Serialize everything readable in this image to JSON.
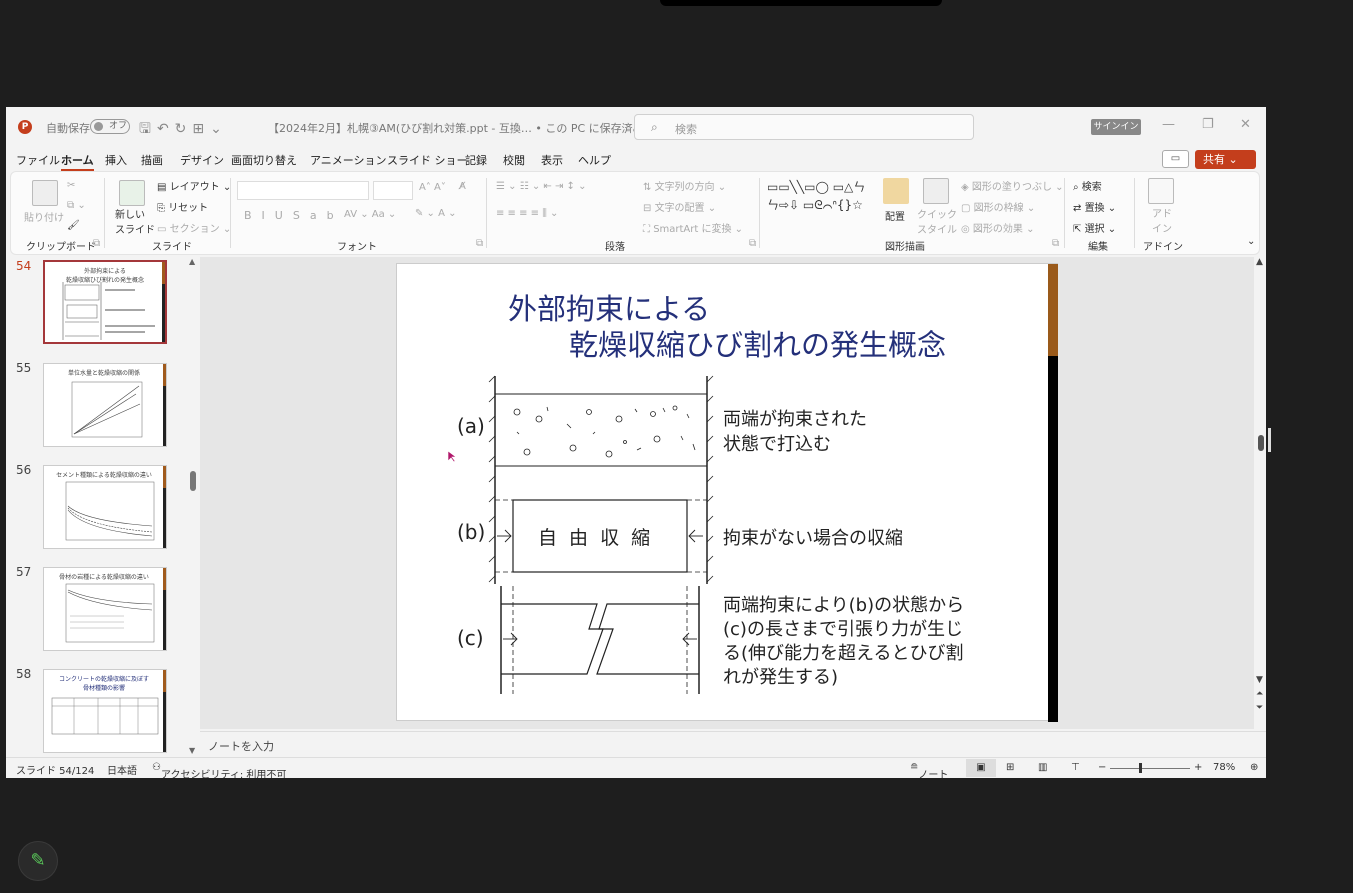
{
  "title_bar": {
    "autosave_label": "自動保存",
    "autosave_state": "オフ",
    "document_title": "【2024年2月】札幌③AM(ひび割れ対策.ppt  -  互換…  •  この PC に保存済み ⌄",
    "search_placeholder": "検索",
    "signin_label": "サインイン"
  },
  "menu": [
    "ファイル",
    "ホーム",
    "挿入",
    "描画",
    "デザイン",
    "画面切り替え",
    "アニメーション",
    "スライド ショー",
    "記録",
    "校閲",
    "表示",
    "ヘルプ"
  ],
  "active_menu": "ホーム",
  "share_label": "共有",
  "ribbon": {
    "paste_label": "貼り付け",
    "new_slide_label": "新しい\nスライド",
    "layout_label": "レイアウト",
    "reset_label": "リセット",
    "section_label": "セクション",
    "text_direction_label": "文字列の方向",
    "text_align_label": "文字の配置",
    "smartart_label": "SmartArt に変換",
    "arrange_label": "配置",
    "quick_style_label": "クイック\nスタイル",
    "shape_fill_label": "図形の塗りつぶし",
    "shape_outline_label": "図形の枠線",
    "shape_effect_label": "図形の効果",
    "find_label": "検索",
    "replace_label": "置換",
    "select_label": "選択",
    "addin_label": "アド\nイン",
    "groups": {
      "clipboard": "クリップボード",
      "slides": "スライド",
      "font": "フォント",
      "paragraph": "段落",
      "drawing": "図形描画",
      "editing": "編集",
      "addins": "アドイン"
    }
  },
  "thumbnails": [
    {
      "number": "54",
      "title": "外部拘束による\n乾燥収縮ひび割れの発生概念",
      "current": true
    },
    {
      "number": "55",
      "title": "単位水量と乾燥収縮の関係",
      "current": false
    },
    {
      "number": "56",
      "title": "セメント種類による乾燥収縮の違い",
      "current": false
    },
    {
      "number": "57",
      "title": "骨材の岩種による乾燥収縮の違い",
      "current": false
    },
    {
      "number": "58",
      "title": "コンクリートの乾燥収縮に及ぼす\n骨材種類の影響",
      "current": false
    }
  ],
  "slide": {
    "title_line1": "外部拘束による",
    "title_line2": "乾燥収縮ひび割れの発生概念",
    "label_a": "(a)",
    "label_b": "(b)",
    "label_c": "(c)",
    "box_b_text": "自 由 収 縮",
    "desc_a1": "両端が拘束された",
    "desc_a2": "状態で打込む",
    "desc_b": "拘束がない場合の収縮",
    "desc_c1": "両端拘束により(b)の状態から",
    "desc_c2": "(c)の長さまで引張り力が生じ",
    "desc_c3": "る(伸び能力を超えるとひび割",
    "desc_c4": "れが発生する)"
  },
  "notes_placeholder": "ノートを入力",
  "status": {
    "slide_count": "スライド 54/124",
    "language": "日本語",
    "accessibility": "アクセシビリティ: 利用不可",
    "notes_button": "ノート",
    "zoom": "78%"
  }
}
